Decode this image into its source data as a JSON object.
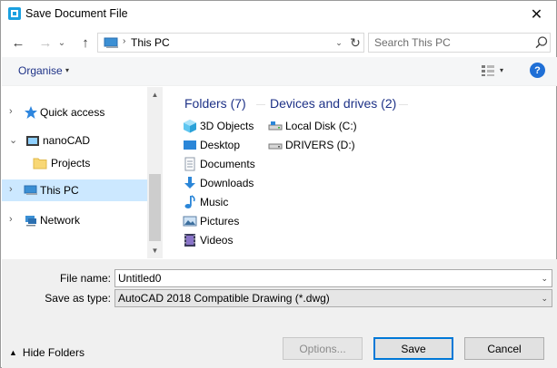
{
  "window": {
    "title": "Save Document File",
    "close_glyph": "✕"
  },
  "nav": {
    "back": "←",
    "forward": "→",
    "recent": "⌄",
    "up": "↑"
  },
  "address": {
    "separator": "›",
    "location": "This PC",
    "dropdown": "⌄",
    "refresh": "↻"
  },
  "search": {
    "placeholder": "Search This PC"
  },
  "toolbar": {
    "organise_label": "Organise",
    "caret": "▾",
    "view_caret": "▾",
    "help_label": "?"
  },
  "navpane": {
    "items": [
      {
        "label": "Quick access",
        "chevron": "›",
        "icon": "star-icon"
      },
      {
        "label": "nanoCAD",
        "chevron": "⌄",
        "icon": "nanocad-icon"
      },
      {
        "label": "Projects",
        "chevron": "",
        "icon": "folder-icon"
      },
      {
        "label": "This PC",
        "chevron": "›",
        "icon": "computer-icon",
        "selected": true
      },
      {
        "label": "Network",
        "chevron": "›",
        "icon": "network-icon"
      }
    ]
  },
  "content": {
    "folders_header": "Folders (7)",
    "drives_header": "Devices and drives (2)",
    "folders": [
      {
        "label": "3D Objects",
        "icon": "3d-objects-icon"
      },
      {
        "label": "Desktop",
        "icon": "desktop-icon"
      },
      {
        "label": "Documents",
        "icon": "documents-icon"
      },
      {
        "label": "Downloads",
        "icon": "downloads-icon"
      },
      {
        "label": "Music",
        "icon": "music-icon"
      },
      {
        "label": "Pictures",
        "icon": "pictures-icon"
      },
      {
        "label": "Videos",
        "icon": "videos-icon"
      }
    ],
    "drives": [
      {
        "label": "Local Disk (C:)",
        "icon": "local-disk-icon"
      },
      {
        "label": "DRIVERS (D:)",
        "icon": "drive-icon"
      }
    ]
  },
  "form": {
    "filename_label": "File name:",
    "filename_value": "Untitled0",
    "type_label": "Save as type:",
    "type_value": "AutoCAD 2018 Compatible Drawing (*.dwg)",
    "caret": "⌄"
  },
  "footer": {
    "hide_folders_label": "Hide Folders",
    "hide_caret": "▲",
    "options_label": "Options...",
    "save_label": "Save",
    "cancel_label": "Cancel"
  },
  "colors": {
    "accent": "#0078d7",
    "link": "#1e3287",
    "selection": "#cce8ff"
  }
}
